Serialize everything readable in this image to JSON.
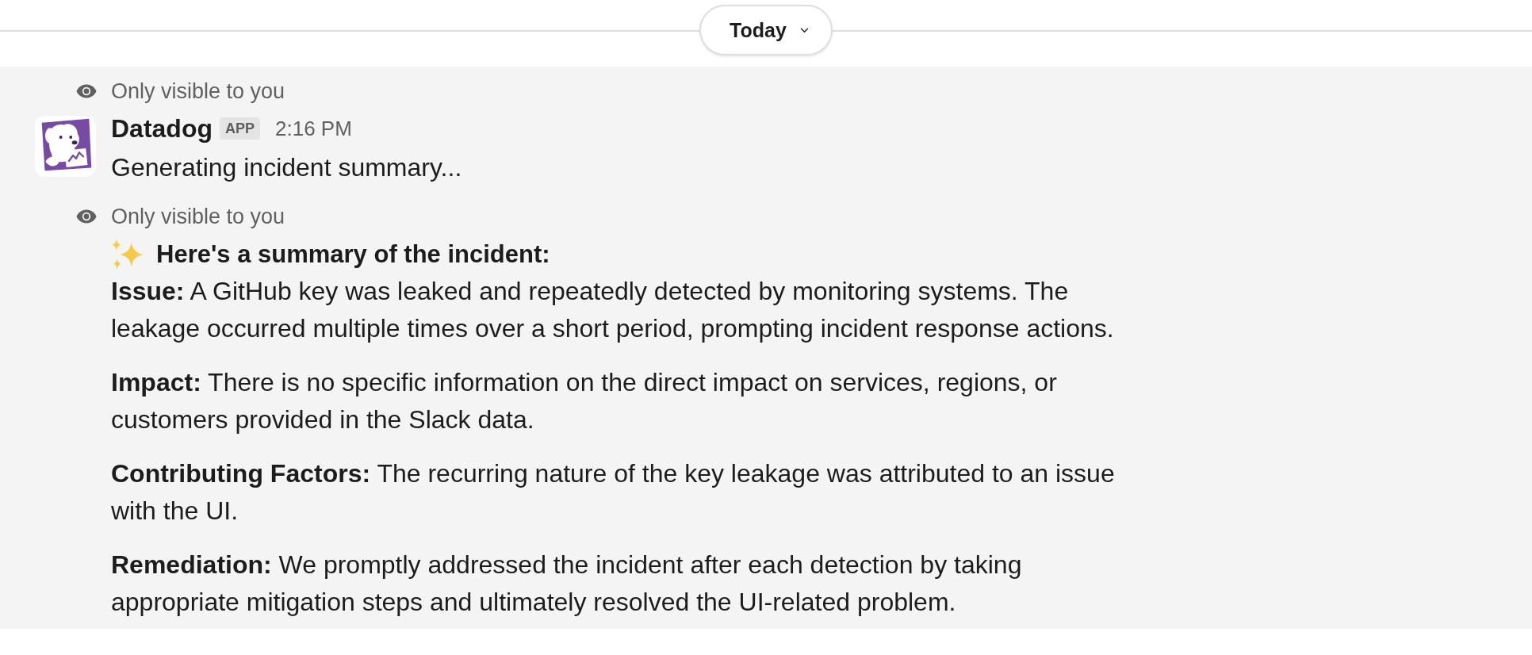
{
  "date_divider": {
    "label": "Today"
  },
  "messages": [
    {
      "kind": "header",
      "notice": "Only visible to you",
      "sender": "Datadog",
      "badge": "APP",
      "time": "2:16 PM",
      "text": "Generating incident summary..."
    },
    {
      "kind": "summary",
      "notice": "Only visible to you",
      "heading": "Here's a summary of the incident:",
      "paragraphs": [
        "**Issue:** A GitHub key was leaked and repeatedly detected by monitoring systems. The leakage occurred multiple times over a short period, prompting incident response actions.",
        "**Impact:** There is no specific information on the direct impact on services, regions, or customers provided in the Slack data.",
        "**Contributing Factors:** The recurring nature of the key leakage was attributed to an issue with the UI.",
        "**Remediation:** We promptly addressed the incident after each detection by taking appropriate mitigation steps and ultimately resolved the UI-related problem."
      ]
    }
  ]
}
